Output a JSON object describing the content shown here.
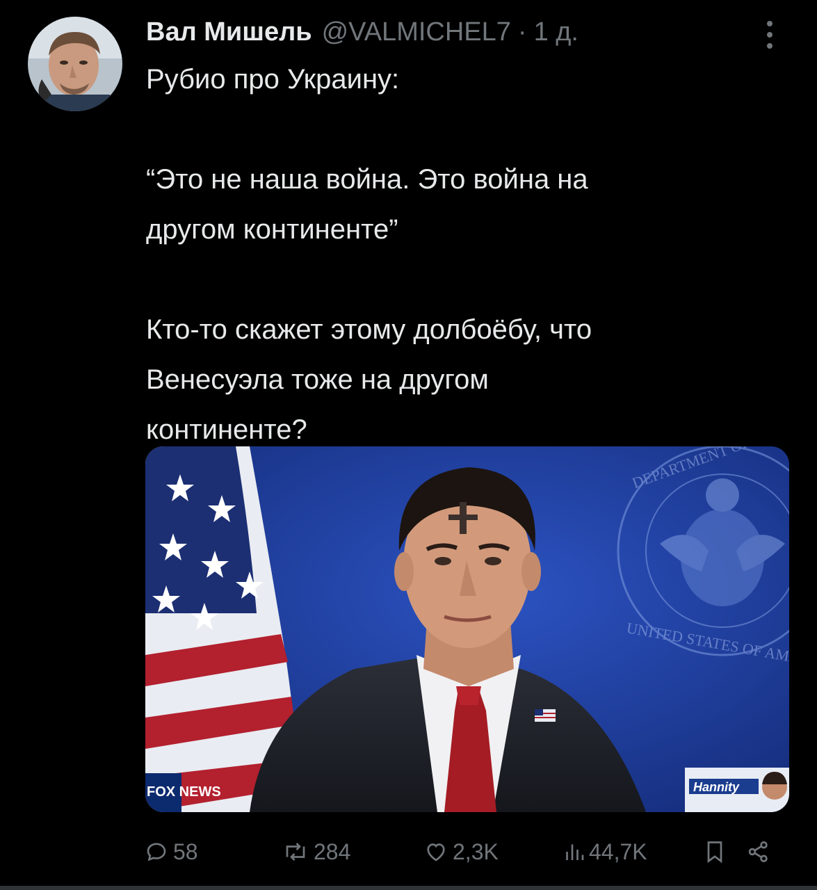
{
  "author": {
    "display_name": "Вал Мишель",
    "handle": "@VALMICHEL7",
    "separator": "·",
    "time": "1 д."
  },
  "tweet": {
    "line1": "Рубио про Украину:",
    "line2": "“Это не наша война. Это война на",
    "line3": "другом континенте”",
    "line4": "Кто-то скажет этому долбоёбу, что",
    "line5": "Венесуэла тоже на другом",
    "line6": "континенте?"
  },
  "media": {
    "seal_top_text": "DEPARTMENT OF STATE",
    "seal_bottom_text": "UNITED STATES OF AMERICA",
    "network_logo": "FOX NEWS",
    "show_logo": "Hannity"
  },
  "actions": {
    "replies": "58",
    "reposts": "284",
    "likes": "2,3K",
    "views": "44,7K"
  },
  "icons": {
    "more": "more-dots-icon",
    "reply": "reply-bubble-icon",
    "repost": "repost-arrows-icon",
    "like": "heart-icon",
    "views": "bar-chart-icon",
    "bookmark": "bookmark-icon",
    "share": "share-nodes-icon"
  },
  "colors": {
    "background": "#000000",
    "text": "#e7e9ea",
    "secondary": "#71767b",
    "photo_backdrop": "#1f3f9a"
  }
}
